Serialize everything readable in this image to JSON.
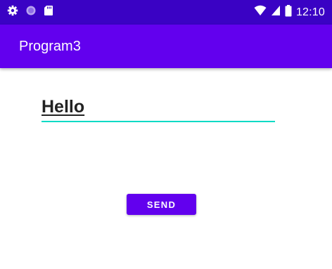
{
  "status_bar": {
    "time": "12:10",
    "left_icons": [
      "gear-icon",
      "circle-icon",
      "sd-card-icon"
    ],
    "right_icons": [
      "wifi-icon",
      "signal-icon",
      "battery-icon"
    ],
    "background": "#3a02c4"
  },
  "app_bar": {
    "title": "Program3",
    "background": "#6200ee"
  },
  "edit_text": {
    "value": "Hello",
    "underline_color": "#03dac5"
  },
  "send_button": {
    "label": "SEND",
    "background": "#6200ee"
  }
}
